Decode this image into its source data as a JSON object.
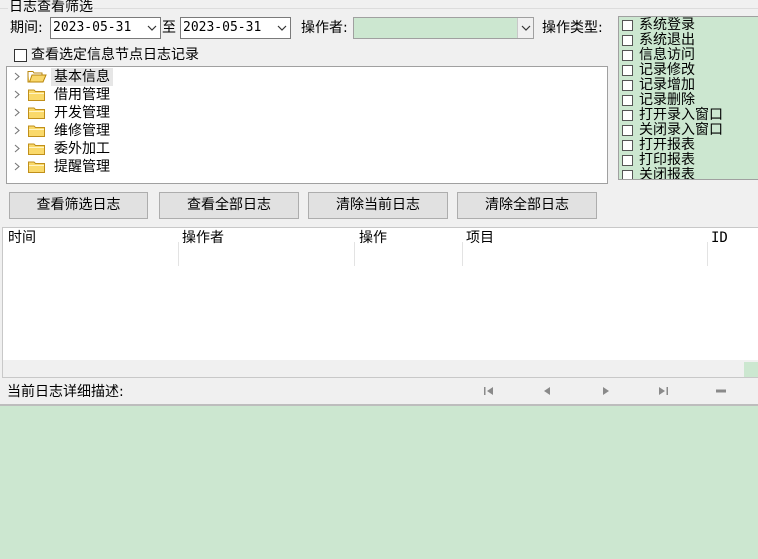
{
  "filter": {
    "group_title": "日志查看筛选",
    "period_label": "期间:",
    "start_date": "2023-05-31",
    "to_label": "至",
    "end_date": "2023-05-31",
    "operator_label": "操作者:",
    "operator_value": "",
    "optype_label": "操作类型:",
    "selected_node_label": "查看选定信息节点日志记录"
  },
  "tree": {
    "items": [
      {
        "label": "基本信息",
        "expanded": true,
        "selected": true
      },
      {
        "label": "借用管理",
        "expanded": false,
        "selected": false
      },
      {
        "label": "开发管理",
        "expanded": false,
        "selected": false
      },
      {
        "label": "维修管理",
        "expanded": false,
        "selected": false
      },
      {
        "label": "委外加工",
        "expanded": false,
        "selected": false
      },
      {
        "label": "提醒管理",
        "expanded": false,
        "selected": false
      }
    ]
  },
  "op_types": [
    {
      "label": "系统登录",
      "checked": false
    },
    {
      "label": "系统退出",
      "checked": false
    },
    {
      "label": "信息访问",
      "checked": false
    },
    {
      "label": "记录修改",
      "checked": false
    },
    {
      "label": "记录增加",
      "checked": false
    },
    {
      "label": "记录删除",
      "checked": false
    },
    {
      "label": "打开录入窗口",
      "checked": false
    },
    {
      "label": "关闭录入窗口",
      "checked": false
    },
    {
      "label": "打开报表",
      "checked": false
    },
    {
      "label": "打印报表",
      "checked": false
    },
    {
      "label": "关闭报表",
      "checked": false
    }
  ],
  "buttons": {
    "view_filtered": "查看筛选日志",
    "view_all": "查看全部日志",
    "clear_current": "清除当前日志",
    "clear_all": "清除全部日志"
  },
  "grid": {
    "columns": [
      "时间",
      "操作者",
      "操作",
      "项目",
      "ID"
    ],
    "rows": []
  },
  "detail": {
    "label": "当前日志详细描述:"
  },
  "colors": {
    "panel_green": "#cce7d0",
    "window_bg": "#f0f0f0"
  }
}
